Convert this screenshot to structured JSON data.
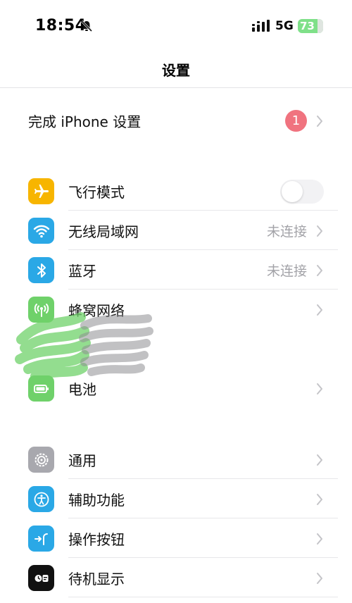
{
  "status_bar": {
    "time": "18:54",
    "network": "5G",
    "battery_percent": "73",
    "battery_level": 0.73
  },
  "nav": {
    "title": "设置"
  },
  "setup": {
    "label": "完成 iPhone 设置",
    "badge": "1"
  },
  "group1": [
    {
      "label": "飞行模式",
      "icon": "airplane-icon",
      "color": "#f7b500",
      "toggle": false
    },
    {
      "label": "无线局域网",
      "icon": "wifi-icon",
      "color": "#2aa8e6",
      "value": "未连接"
    },
    {
      "label": "蓝牙",
      "icon": "bluetooth-icon",
      "color": "#2aa8e6",
      "value": "未连接"
    },
    {
      "label": "蜂窝网络",
      "icon": "cellular-icon",
      "color": "#6fd16a"
    },
    {
      "label": "电池",
      "icon": "battery-icon",
      "color": "#6fd16a"
    }
  ],
  "group2": [
    {
      "label": "通用",
      "icon": "gear-icon",
      "color": "#a8a8ae"
    },
    {
      "label": "辅助功能",
      "icon": "accessibility-icon",
      "color": "#2aa8e6"
    },
    {
      "label": "操作按钮",
      "icon": "action-button-icon",
      "color": "#2aa8e6"
    },
    {
      "label": "待机显示",
      "icon": "standby-icon",
      "color": "#111111"
    }
  ]
}
